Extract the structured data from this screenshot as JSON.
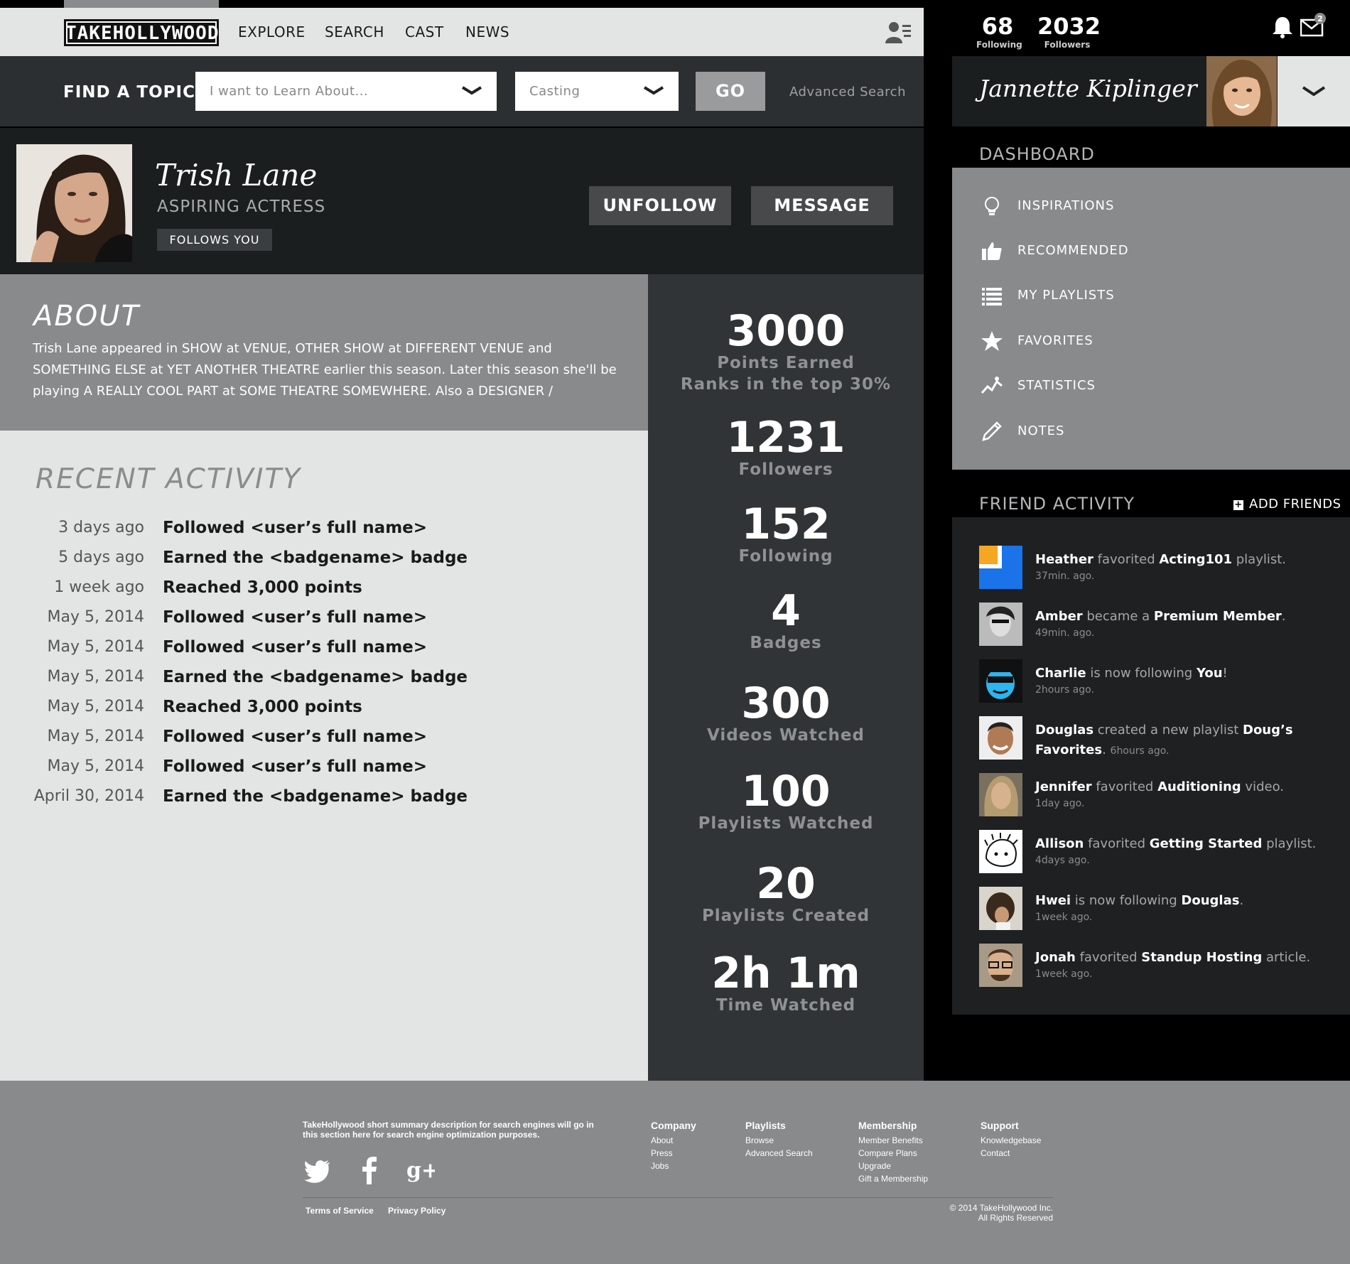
{
  "brand": {
    "logo_text": "TAKEHOLLYWOOD"
  },
  "nav": {
    "items": [
      "EXPLORE",
      "SEARCH",
      "CAST",
      "NEWS"
    ]
  },
  "find": {
    "label": "FIND A TOPIC",
    "topic_placeholder": "I want to Learn About...",
    "category_value": "Casting",
    "go_label": "GO",
    "advanced_label": "Advanced Search"
  },
  "profile": {
    "name": "Trish Lane",
    "role": "ASPIRING ACTRESS",
    "follows_badge": "FOLLOWS YOU",
    "unfollow_label": "UNFOLLOW",
    "message_label": "MESSAGE"
  },
  "about": {
    "title": "ABOUT",
    "text": "Trish Lane appeared in SHOW at VENUE, OTHER SHOW at DIFFERENT VENUE and SOMETHING ELSE at YET ANOTHER THEATRE earlier this season.  Later this season she'll be playing A REALLY COOL PART at SOME THEATRE SOMEWHERE.  Also a DESIGNER /"
  },
  "recent": {
    "title": "RECENT ACTIVITY",
    "items": [
      {
        "date": "3 days ago",
        "text": "Followed <user’s full name>"
      },
      {
        "date": "5 days ago",
        "text": "Earned the <badgename> badge"
      },
      {
        "date": "1 week ago",
        "text": "Reached 3,000 points"
      },
      {
        "date": "May 5, 2014",
        "text": "Followed <user’s full name>"
      },
      {
        "date": "May 5, 2014",
        "text": "Followed <user’s full name>"
      },
      {
        "date": "May 5, 2014",
        "text": "Earned the <badgename> badge"
      },
      {
        "date": "May 5, 2014",
        "text": "Reached 3,000 points"
      },
      {
        "date": "May 5, 2014",
        "text": "Followed <user’s full name>"
      },
      {
        "date": "May 5, 2014",
        "text": "Followed <user’s full name>"
      },
      {
        "date": "April 30, 2014",
        "text": "Earned the <badgename> badge"
      }
    ]
  },
  "stats": [
    {
      "value": "3000",
      "label": "Points Earned",
      "sub": "Ranks in the top 30%"
    },
    {
      "value": "1231",
      "label": "Followers"
    },
    {
      "value": "152",
      "label": "Following"
    },
    {
      "value": "4",
      "label": "Badges"
    },
    {
      "value": "300",
      "label": "Videos Watched"
    },
    {
      "value": "100",
      "label": "Playlists Watched"
    },
    {
      "value": "20",
      "label": "Playlists Created"
    },
    {
      "value": "2h 1m",
      "label": "Time Watched"
    }
  ],
  "account": {
    "following_count": "68",
    "following_label": "Following",
    "followers_count": "2032",
    "followers_label": "Followers",
    "mail_badge": "2",
    "user_name": "Jannette Kiplinger"
  },
  "dashboard": {
    "title": "DASHBOARD",
    "items": [
      {
        "label": "INSPIRATIONS",
        "icon": "lightbulb-icon"
      },
      {
        "label": "RECOMMENDED",
        "icon": "thumbs-up-icon"
      },
      {
        "label": "MY PLAYLISTS",
        "icon": "list-icon"
      },
      {
        "label": "FAVORITES",
        "icon": "star-icon"
      },
      {
        "label": "STATISTICS",
        "icon": "chart-line-icon"
      },
      {
        "label": "NOTES",
        "icon": "pencil-icon"
      }
    ]
  },
  "friends": {
    "title": "FRIEND ACTIVITY",
    "add_label": "ADD FRIENDS",
    "items": [
      {
        "name": "Heather",
        "verb": " favorited ",
        "obj": "Acting101",
        "tail": " playlist.",
        "time": "37min. ago."
      },
      {
        "name": "Amber",
        "verb": " became a ",
        "obj": "Premium Member",
        "tail": ".",
        "time": "49min. ago."
      },
      {
        "name": "Charlie",
        "verb": " is now following ",
        "obj": "You",
        "tail": "!",
        "time": "2hours ago."
      },
      {
        "name": "Douglas",
        "verb": " created a new playlist ",
        "obj": "Doug’s Favorites",
        "tail": ".",
        "time": "6hours ago."
      },
      {
        "name": "Jennifer",
        "verb": " favorited ",
        "obj": "Auditioning",
        "tail": " video.",
        "time": "1day ago."
      },
      {
        "name": "Allison",
        "verb": " favorited ",
        "obj": "Getting Started",
        "tail": " playlist.",
        "time": "4days ago."
      },
      {
        "name": "Hwei",
        "verb": " is now following ",
        "obj": "Douglas",
        "tail": ".",
        "time": "1week ago."
      },
      {
        "name": "Jonah",
        "verb": " favorited ",
        "obj": "Standup Hosting",
        "tail": " article.",
        "time": "1week ago."
      }
    ]
  },
  "footer": {
    "description": "TakeHollywood short summary description for  search engines will go in this section here for search engine optimization purposes.",
    "columns": [
      {
        "title": "Company",
        "links": [
          "About",
          "Press",
          "Jobs"
        ]
      },
      {
        "title": "Playlists",
        "links": [
          "Browse",
          "Advanced Search"
        ]
      },
      {
        "title": "Membership",
        "links": [
          "Member Benefits",
          "Compare Plans",
          "Upgrade",
          "Gift a Membership"
        ]
      },
      {
        "title": "Support",
        "links": [
          "Knowledgebase",
          "Contact"
        ]
      }
    ],
    "terms": "Terms of Service",
    "privacy": "Privacy Policy",
    "copyright_1": "© 2014 TakeHollywood Inc.",
    "copyright_2": "All Rights Reserved"
  }
}
